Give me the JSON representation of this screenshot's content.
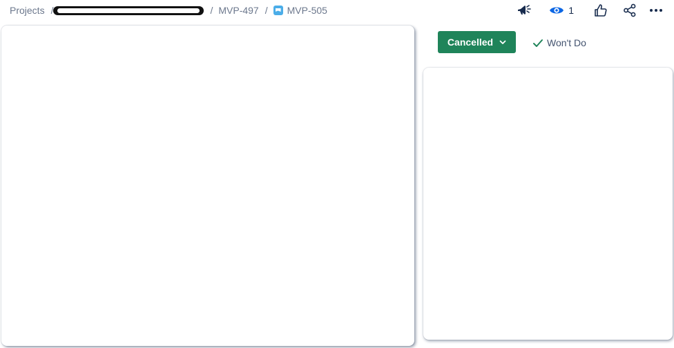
{
  "breadcrumb": {
    "projects": "Projects",
    "separator": "/",
    "parent_issue": "MVP-497",
    "current_issue": "MVP-505"
  },
  "actions": {
    "watch_count": "1"
  },
  "status": {
    "label": "Cancelled",
    "color": "#1f845a"
  },
  "resolution": {
    "label": "Won't Do"
  },
  "icons": {
    "announce": "megaphone-icon",
    "watch": "eye-icon",
    "like": "thumbs-up-icon",
    "share": "share-icon",
    "more": "more-icon",
    "issue_type": "story-icon",
    "status_chevron": "chevron-down-icon",
    "resolution": "check-icon"
  }
}
